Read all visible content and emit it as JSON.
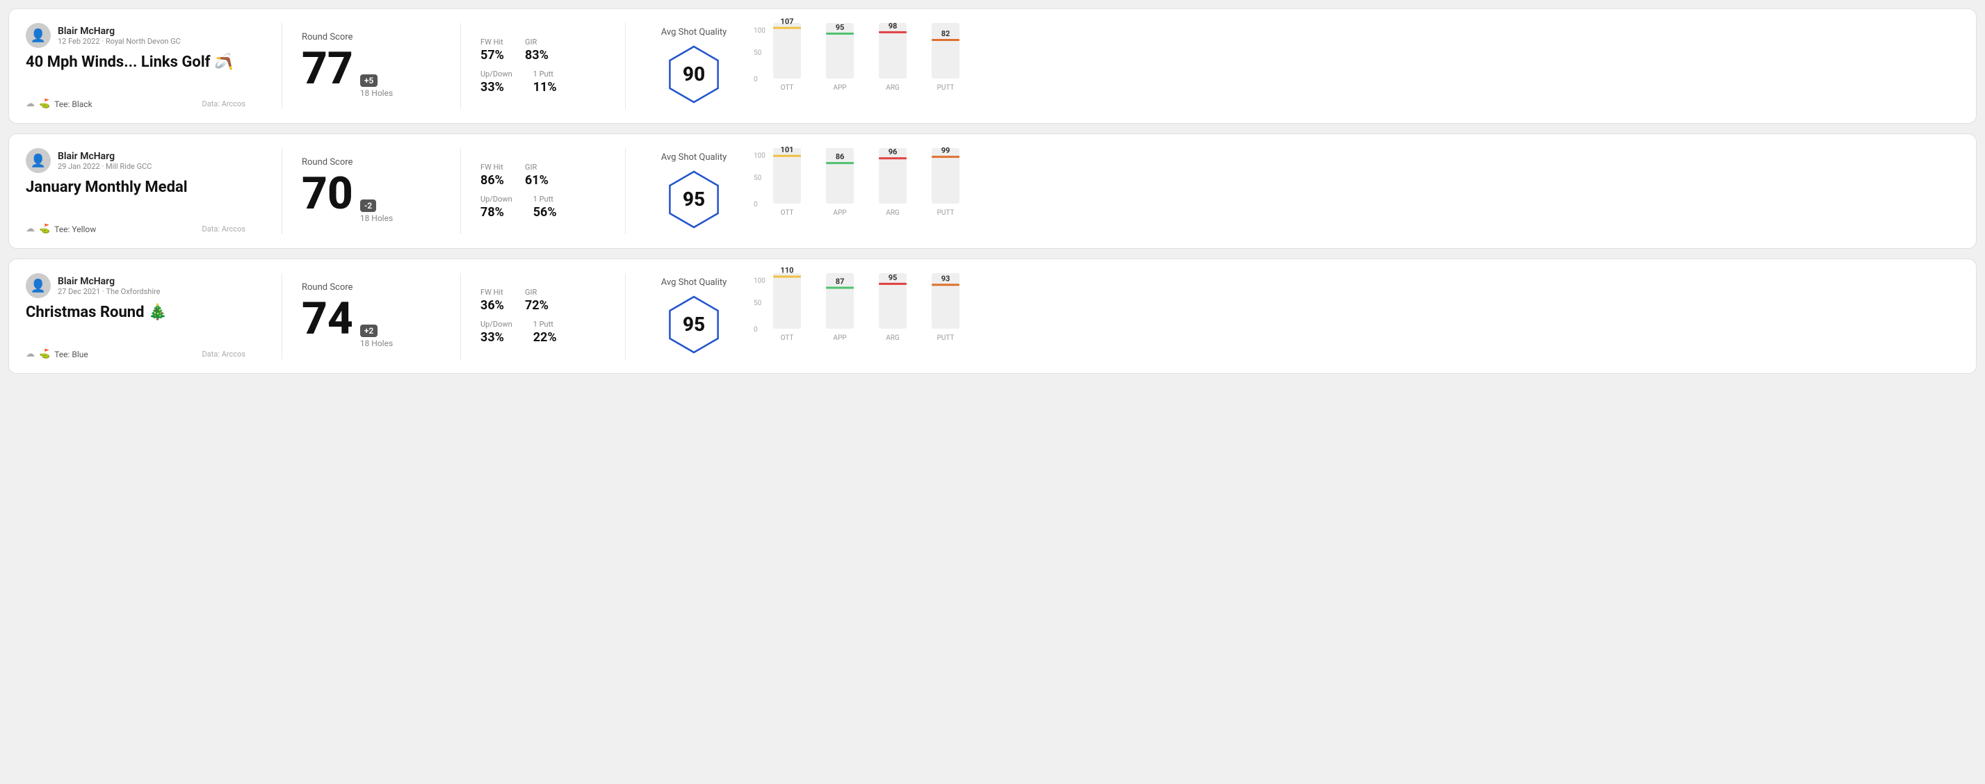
{
  "rounds": [
    {
      "id": "round1",
      "user": {
        "name": "Blair McHarg",
        "meta": "12 Feb 2022 · Royal North Devon GC"
      },
      "title": "40 Mph Winds... Links Golf 🪃",
      "tee": "Black",
      "data_source": "Data: Arccos",
      "round_score_label": "Round Score",
      "score": "77",
      "score_diff": "+5",
      "holes": "18 Holes",
      "fw_hit_label": "FW Hit",
      "fw_hit": "57%",
      "gir_label": "GIR",
      "gir": "83%",
      "updown_label": "Up/Down",
      "updown": "33%",
      "oneputt_label": "1 Putt",
      "oneputt": "11%",
      "avg_quality_label": "Avg Shot Quality",
      "quality_score": "90",
      "bars": [
        {
          "label": "OTT",
          "value": 107,
          "color": "#f0c040"
        },
        {
          "label": "APP",
          "value": 95,
          "color": "#50c070"
        },
        {
          "label": "ARG",
          "value": 98,
          "color": "#e04040"
        },
        {
          "label": "PUTT",
          "value": 82,
          "color": "#e07030"
        }
      ]
    },
    {
      "id": "round2",
      "user": {
        "name": "Blair McHarg",
        "meta": "29 Jan 2022 · Mill Ride GCC"
      },
      "title": "January Monthly Medal",
      "tee": "Yellow",
      "data_source": "Data: Arccos",
      "round_score_label": "Round Score",
      "score": "70",
      "score_diff": "-2",
      "holes": "18 Holes",
      "fw_hit_label": "FW Hit",
      "fw_hit": "86%",
      "gir_label": "GIR",
      "gir": "61%",
      "updown_label": "Up/Down",
      "updown": "78%",
      "oneputt_label": "1 Putt",
      "oneputt": "56%",
      "avg_quality_label": "Avg Shot Quality",
      "quality_score": "95",
      "bars": [
        {
          "label": "OTT",
          "value": 101,
          "color": "#f0c040"
        },
        {
          "label": "APP",
          "value": 86,
          "color": "#50c070"
        },
        {
          "label": "ARG",
          "value": 96,
          "color": "#e04040"
        },
        {
          "label": "PUTT",
          "value": 99,
          "color": "#e07030"
        }
      ]
    },
    {
      "id": "round3",
      "user": {
        "name": "Blair McHarg",
        "meta": "27 Dec 2021 · The Oxfordshire"
      },
      "title": "Christmas Round 🎄",
      "tee": "Blue",
      "data_source": "Data: Arccos",
      "round_score_label": "Round Score",
      "score": "74",
      "score_diff": "+2",
      "holes": "18 Holes",
      "fw_hit_label": "FW Hit",
      "fw_hit": "36%",
      "gir_label": "GIR",
      "gir": "72%",
      "updown_label": "Up/Down",
      "updown": "33%",
      "oneputt_label": "1 Putt",
      "oneputt": "22%",
      "avg_quality_label": "Avg Shot Quality",
      "quality_score": "95",
      "bars": [
        {
          "label": "OTT",
          "value": 110,
          "color": "#f0c040"
        },
        {
          "label": "APP",
          "value": 87,
          "color": "#50c070"
        },
        {
          "label": "ARG",
          "value": 95,
          "color": "#e04040"
        },
        {
          "label": "PUTT",
          "value": 93,
          "color": "#e07030"
        }
      ]
    }
  ]
}
